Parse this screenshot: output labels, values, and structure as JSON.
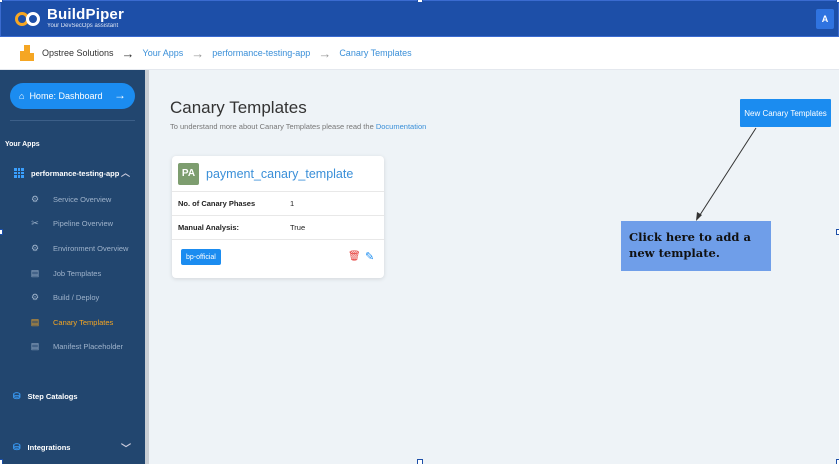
{
  "header": {
    "logo_name": "BuildPiper",
    "logo_tagline": "Your DevSecOps assistant",
    "avatar_initial": "A"
  },
  "breadcrumb": {
    "items": [
      "Opstree Solutions",
      "Your Apps",
      "performance-testing-app",
      "Canary Templates"
    ]
  },
  "sidebar": {
    "home_label": "Home: Dashboard",
    "apps_heading": "Your Apps",
    "app_name": "performance-testing-app",
    "items": [
      {
        "label": "Service Overview",
        "icon": "gear-icon"
      },
      {
        "label": "Pipeline Overview",
        "icon": "tools-icon"
      },
      {
        "label": "Environment Overview",
        "icon": "gear-icon"
      },
      {
        "label": "Job Templates",
        "icon": "document-icon"
      },
      {
        "label": "Build / Deploy",
        "icon": "gear-icon"
      },
      {
        "label": "Canary Templates",
        "icon": "document-icon",
        "active": true
      },
      {
        "label": "Manifest Placeholder",
        "icon": "document-icon"
      }
    ],
    "step_catalogs": "Step Catalogs",
    "integrations": "Integrations"
  },
  "main": {
    "title": "Canary Templates",
    "subtitle_text": "To understand more about Canary Templates please read the",
    "subtitle_link": "Documentation",
    "new_button": "New Canary Templates",
    "card": {
      "badge": "PA",
      "title": "payment_canary_template",
      "rows": [
        {
          "key": "No. of Canary Phases",
          "value": "1"
        },
        {
          "key": "Manual Analysis:",
          "value": "True"
        }
      ],
      "tag": "bp-official"
    },
    "callout": "Click here to add a new template."
  },
  "colors": {
    "topbar": "#1d4fa8",
    "sidebar": "#22466f",
    "accent": "#1b8cf0",
    "active": "#f5a623",
    "callout": "#6f9ee9"
  }
}
